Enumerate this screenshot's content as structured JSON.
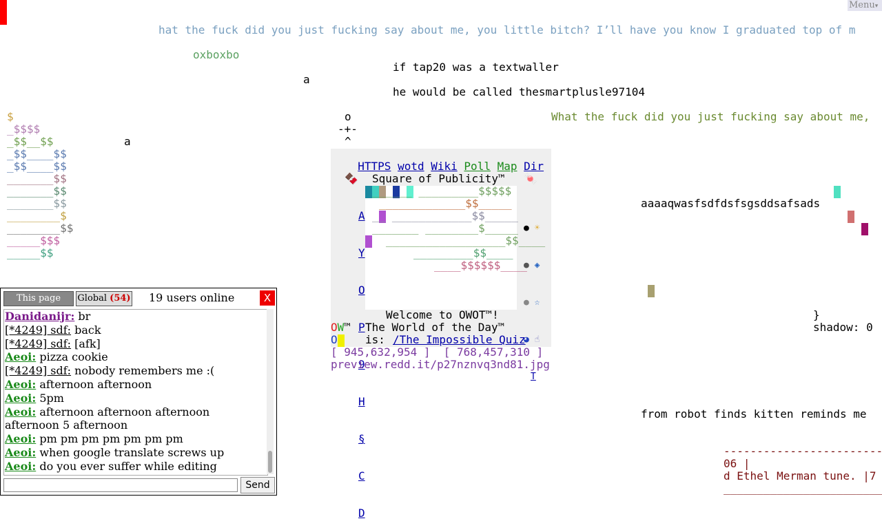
{
  "menu_label": "Menu",
  "texts": {
    "wf1": "hat the fuck did you just fucking say about me, you little bitch? I’ll have you know I graduated top of m",
    "oxbo": "oxboxbo",
    "tap1": "if tap20 was a textwaller",
    "a1": "a",
    "tap2": "he would be called thesmartplusle97104",
    "wf2": "What the fuck did you just fucking say about me,",
    "a2": "a",
    "aaa": "aaaaqwasfsdfdsfsgsddsafsads",
    "brace": "}",
    "shadow": "shadow: 0",
    "robot": "from robot finds kitten reminds me",
    "dash": "----------------------------",
    "n06": "06 |",
    "ethel": "d Ethel Merman tune. |7",
    "under": "___________________________"
  },
  "figure": [
    "o",
    "-+-",
    "^"
  ],
  "dollar_art": [
    "$",
    "_$$$$",
    "_$$__$$",
    "_$$____$$",
    "_$$____$$",
    "_______$$",
    "_______$$",
    "_______$$",
    "________$",
    "________$$",
    "_____$$$",
    "_____$$"
  ],
  "nav": {
    "https": "HTTPS",
    "wotd": "wotd",
    "wiki": "Wiki",
    "poll": "Poll",
    "map": "Map",
    "dir": "Dir"
  },
  "square": {
    "title": "Square of Publicity™",
    "left_emoji": "🍫",
    "right_emoji": "🍬",
    "letters": [
      "A",
      "Y",
      "O",
      "P",
      "9",
      "H",
      "§",
      "C",
      "D"
    ],
    "right_icons": [
      "●",
      "☀",
      "●",
      "◈",
      "●",
      "☆",
      "◕",
      "☝",
      "T"
    ],
    "art": [
      "",
      "",
      "",
      "______ _________$$$$$",
      "_____________$$_____",
      "__ ____________$$_____",
      "_______ ________$_____",
      "__________________$$____",
      "_________$$____",
      "____$$$$$$____"
    ],
    "welcome": "Welcome to OWOT™!",
    "ow": "OW™",
    "o": "O",
    "wotd_line": "The World of the Day™",
    "is": "is:",
    "wotd_link": "/The Impossible Quiz"
  },
  "coords": "[ 945,632,954 ]  [ 768,457,310 ]",
  "preview": "preview.redd.it/p27nznvq3nd81.jpg",
  "chat": {
    "tab_this": "This page",
    "tab_global": "Global",
    "global_count": "(54)",
    "users_online": "19 users online",
    "close": "X",
    "send": "Send",
    "messages": [
      {
        "name": "Danidanijr:",
        "style": "purple",
        "text": " br"
      },
      {
        "name": "[*4249] sdf:",
        "style": "anon",
        "text": " back"
      },
      {
        "name": "[*4249] sdf:",
        "style": "anon",
        "text": " [afk]"
      },
      {
        "name": "Aeoi:",
        "style": "green",
        "text": " pizza cookie"
      },
      {
        "name": "[*4249] sdf:",
        "style": "anon",
        "text": " nobody remembers me :("
      },
      {
        "name": "Aeoi:",
        "style": "green",
        "text": " afternoon afternoon"
      },
      {
        "name": "Aeoi:",
        "style": "green",
        "text": " 5pm"
      },
      {
        "name": "Aeoi:",
        "style": "green",
        "text": " afternoon afternoon afternoon afternoon 5 afternoon"
      },
      {
        "name": "Aeoi:",
        "style": "green",
        "text": " pm pm pm pm pm pm pm"
      },
      {
        "name": "Aeoi:",
        "style": "green",
        "text": " when google translate screws up"
      },
      {
        "name": "Aeoi:",
        "style": "green",
        "text": " do you ever suffer while editing"
      }
    ]
  }
}
